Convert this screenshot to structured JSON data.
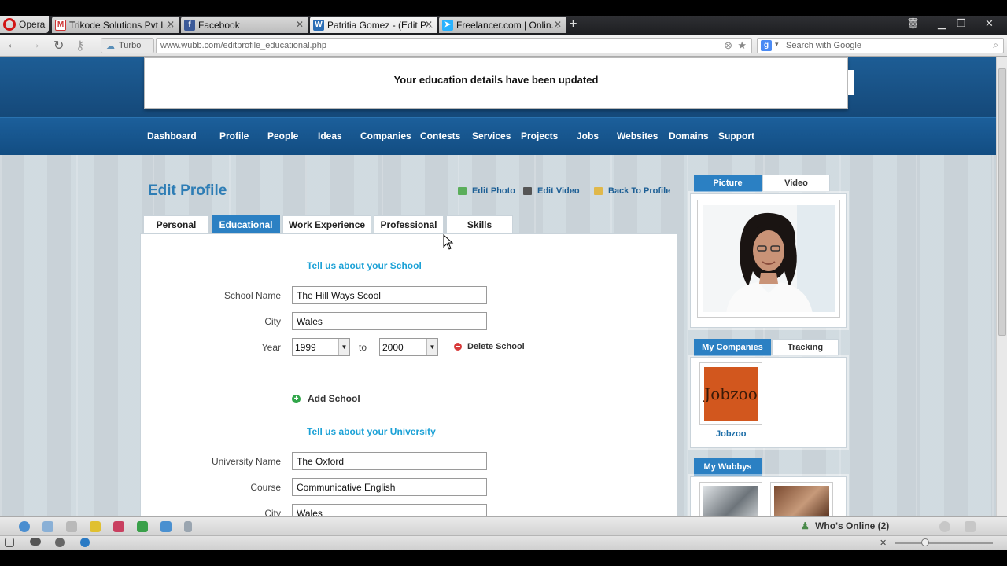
{
  "browser": {
    "opera_label": "Opera",
    "tabs": [
      {
        "title": "Trikode Solutions Pvt L...",
        "icon": "gmail-icon"
      },
      {
        "title": "Facebook",
        "icon": "facebook-icon"
      },
      {
        "title": "Patritia Gomez - (Edit P...",
        "icon": "wubb-icon"
      },
      {
        "title": "Freelancer.com | Onlin...",
        "icon": "freelancer-icon"
      }
    ],
    "turbo_label": "Turbo",
    "url": "www.wubb.com/editprofile_educational.php",
    "search_placeholder": "Search with Google"
  },
  "notice": "Your education details have been updated",
  "menu": [
    "Dashboard",
    "Profile",
    "People",
    "Ideas",
    "Companies",
    "Contests",
    "Services",
    "Projects",
    "Jobs",
    "Websites",
    "Domains",
    "Support"
  ],
  "page_title": "Edit Profile",
  "top_links": {
    "edit_photo": "Edit Photo",
    "edit_video": "Edit Video",
    "back": "Back To Profile"
  },
  "profile_tabs": [
    "Personal",
    "Educational",
    "Work Experience",
    "Professional",
    "Skills"
  ],
  "school": {
    "heading": "Tell us about your School",
    "name_label": "School Name",
    "name_value": "The Hill Ways Scool",
    "city_label": "City",
    "city_value": "Wales",
    "year_label": "Year",
    "year_from": "1999",
    "to_label": "to",
    "year_to": "2000",
    "delete_label": "Delete School",
    "add_label": "Add School"
  },
  "university": {
    "heading": "Tell us about your University",
    "name_label": "University Name",
    "name_value": "The Oxford",
    "course_label": "Course",
    "course_value": "Communicative English",
    "city_label": "City",
    "city_value": "Wales"
  },
  "right": {
    "media_tabs": [
      "Picture",
      "Video"
    ],
    "companies_tabs": [
      "My Companies",
      "Tracking"
    ],
    "company_name": "Jobzoo",
    "company_logo_text": "Jobzoo",
    "wubbys_tab": "My Wubbys"
  },
  "statusbar": {
    "whos_online": "Who's Online (2)"
  }
}
